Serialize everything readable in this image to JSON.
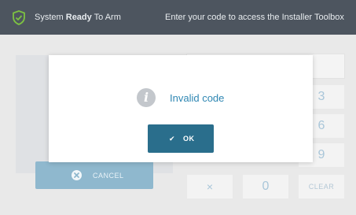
{
  "header": {
    "status_prefix": "System",
    "status_bold": "Ready",
    "status_suffix": "To Arm",
    "prompt": "Enter your code to access the Installer Toolbox",
    "shield_icon": "shield-check-icon",
    "colors": {
      "bar": "#4d555f",
      "shield": "#7dc142"
    }
  },
  "keypad": {
    "keys": [
      {
        "id": "key-3",
        "label": "3"
      },
      {
        "id": "key-6",
        "label": "6"
      },
      {
        "id": "key-9",
        "label": "9"
      },
      {
        "id": "key-x",
        "label": "×"
      },
      {
        "id": "key-0",
        "label": "0"
      },
      {
        "id": "key-clear",
        "label": "CLEAR"
      }
    ]
  },
  "cancel": {
    "label": "CANCEL",
    "icon": "close-circle-icon"
  },
  "modal": {
    "icon": "info-icon",
    "icon_glyph": "i",
    "message": "Invalid code",
    "ok_label": "OK",
    "ok_icon": "check-icon",
    "colors": {
      "message": "#2f87b3",
      "ok_button": "#2a6e8c"
    }
  }
}
